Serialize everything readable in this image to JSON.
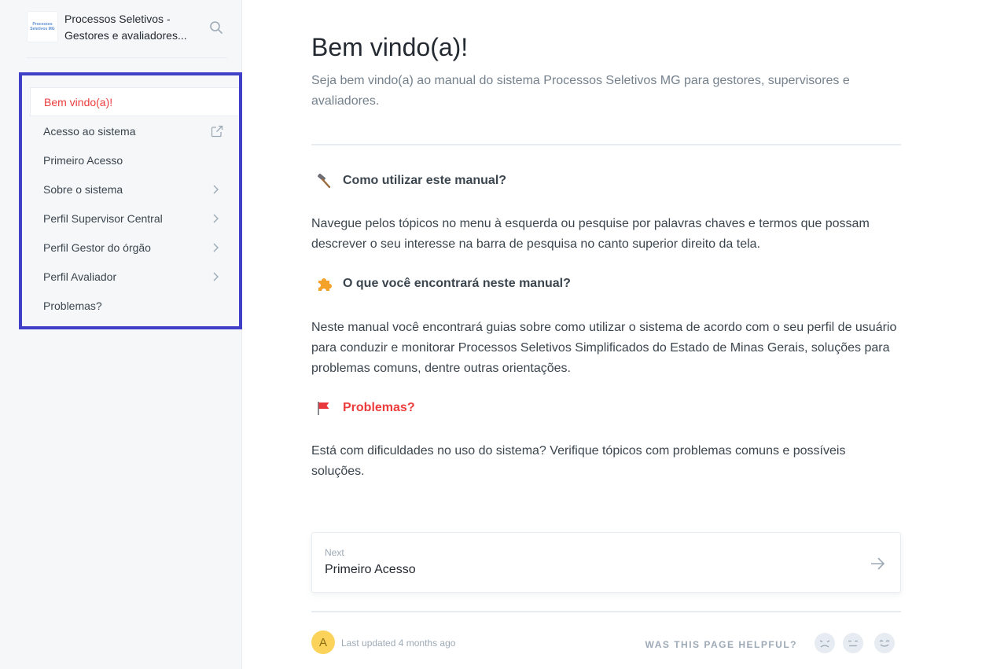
{
  "space": {
    "logo_text_line1": "Processos",
    "logo_text_line2": "Seletivos MG",
    "title_line1": "Processos Seletivos -",
    "title_line2": "Gestores e avaliadores..."
  },
  "nav": {
    "items": [
      {
        "label": "Bem vindo(a)!",
        "active": true,
        "trail": "none"
      },
      {
        "label": "Acesso ao sistema",
        "trail": "external-link-icon"
      },
      {
        "label": "Primeiro Acesso",
        "trail": "none"
      },
      {
        "label": "Sobre o sistema",
        "trail": "chevron-right-icon"
      },
      {
        "label": "Perfil Supervisor Central",
        "trail": "chevron-right-icon"
      },
      {
        "label": "Perfil Gestor do órgão",
        "trail": "chevron-right-icon"
      },
      {
        "label": "Perfil Avaliador",
        "trail": "chevron-right-icon"
      },
      {
        "label": "Problemas?",
        "trail": "none"
      }
    ]
  },
  "page": {
    "title": "Bem vindo(a)!",
    "description": "Seja bem vindo(a) ao manual do sistema Processos Seletivos MG para gestores, supervisores e avaliadores.",
    "sections": [
      {
        "icon": "hammer-icon",
        "heading": "Como utilizar este manual?",
        "body": "Navegue pelos tópicos no menu à esquerda ou pesquise por palavras chaves e termos que possam descrever o seu interesse na barra de pesquisa no canto superior direito da tela."
      },
      {
        "icon": "puzzle-icon",
        "heading": "O que você encontrará neste manual?",
        "body": "Neste manual você encontrará guias sobre como utilizar o sistema de acordo com o seu perfil de usuário para conduzir e monitorar Processos Seletivos Simplificados do Estado de Minas Gerais, soluções para problemas comuns, dentre outras orientações."
      },
      {
        "icon": "red-flag-icon",
        "heading": "Problemas?",
        "body": "Está com dificuldades no uso do sistema? Verifique tópicos com problemas comuns e possíveis soluções."
      }
    ]
  },
  "next": {
    "small_label": "Next",
    "title": "Primeiro Acesso"
  },
  "footer": {
    "avatar_letter": "A",
    "updated": "Last updated 4 months ago",
    "helpful_label": "WAS THIS PAGE HELPFUL?"
  },
  "colors": {
    "accent": "#ed3c3c",
    "highlight_border": "#3f3fc8",
    "sidebar_bg": "#f5f7f9"
  }
}
